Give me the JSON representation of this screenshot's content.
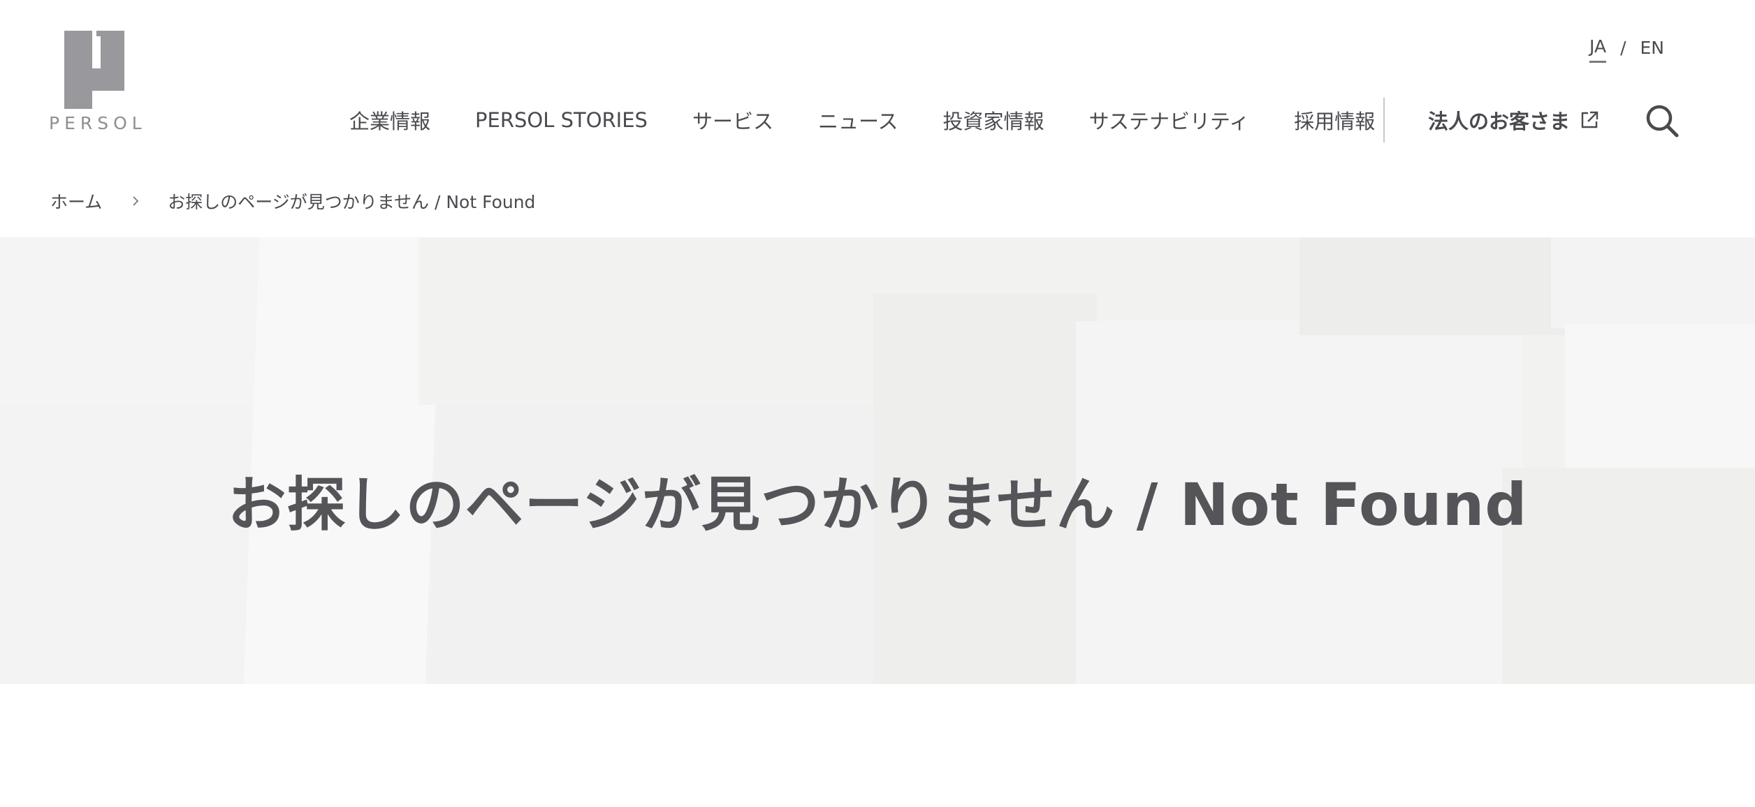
{
  "brand": {
    "logo_text": "PERSOL",
    "logo_color": "#98989d"
  },
  "lang": {
    "ja": "JA",
    "separator": "/",
    "en": "EN"
  },
  "nav": {
    "items": [
      {
        "label": "企業情報"
      },
      {
        "label": "PERSOL STORIES"
      },
      {
        "label": "サービス"
      },
      {
        "label": "ニュース"
      },
      {
        "label": "投資家情報"
      },
      {
        "label": "サステナビリティ"
      },
      {
        "label": "採用情報"
      }
    ],
    "corporate_label": "法人のお客さま",
    "external_icon": "external-link-icon",
    "search_icon": "search-icon"
  },
  "breadcrumb": {
    "home": "ホーム",
    "current": "お探しのページが見つかりません / Not Found"
  },
  "hero": {
    "title": "お探しのページが見つかりません / Not Found"
  },
  "colors": {
    "text": "#4a4a4f",
    "hero_bg": "#f2f2f1",
    "divider": "#c8c8cc"
  }
}
